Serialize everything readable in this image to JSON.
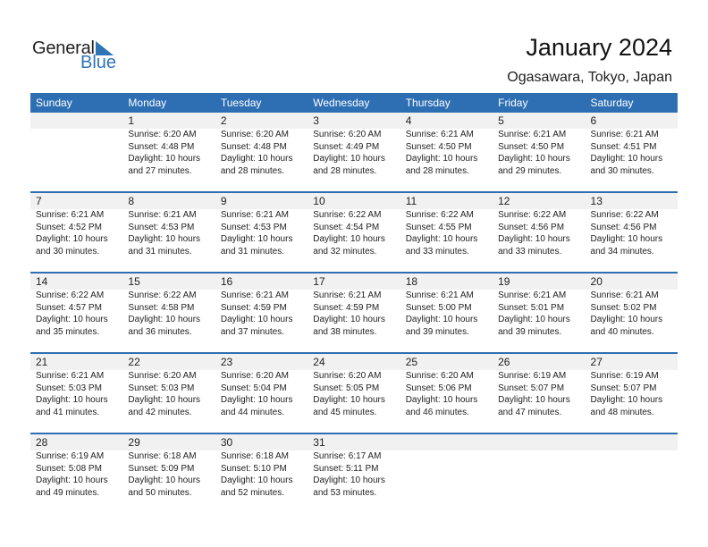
{
  "logo": {
    "general": "General",
    "blue": "Blue",
    "accent_color": "#2e75b6"
  },
  "header": {
    "title": "January 2024",
    "subtitle": "Ogasawara, Tokyo, Japan"
  },
  "colors": {
    "header_bg": "#2e6fb4",
    "date_band": "#f1f1f1"
  },
  "weekdays": [
    "Sunday",
    "Monday",
    "Tuesday",
    "Wednesday",
    "Thursday",
    "Friday",
    "Saturday"
  ],
  "weeks": [
    [
      null,
      {
        "day": "1",
        "sunrise": "Sunrise: 6:20 AM",
        "sunset": "Sunset: 4:48 PM",
        "daylight1": "Daylight: 10 hours",
        "daylight2": "and 27 minutes."
      },
      {
        "day": "2",
        "sunrise": "Sunrise: 6:20 AM",
        "sunset": "Sunset: 4:48 PM",
        "daylight1": "Daylight: 10 hours",
        "daylight2": "and 28 minutes."
      },
      {
        "day": "3",
        "sunrise": "Sunrise: 6:20 AM",
        "sunset": "Sunset: 4:49 PM",
        "daylight1": "Daylight: 10 hours",
        "daylight2": "and 28 minutes."
      },
      {
        "day": "4",
        "sunrise": "Sunrise: 6:21 AM",
        "sunset": "Sunset: 4:50 PM",
        "daylight1": "Daylight: 10 hours",
        "daylight2": "and 28 minutes."
      },
      {
        "day": "5",
        "sunrise": "Sunrise: 6:21 AM",
        "sunset": "Sunset: 4:50 PM",
        "daylight1": "Daylight: 10 hours",
        "daylight2": "and 29 minutes."
      },
      {
        "day": "6",
        "sunrise": "Sunrise: 6:21 AM",
        "sunset": "Sunset: 4:51 PM",
        "daylight1": "Daylight: 10 hours",
        "daylight2": "and 30 minutes."
      }
    ],
    [
      {
        "day": "7",
        "sunrise": "Sunrise: 6:21 AM",
        "sunset": "Sunset: 4:52 PM",
        "daylight1": "Daylight: 10 hours",
        "daylight2": "and 30 minutes."
      },
      {
        "day": "8",
        "sunrise": "Sunrise: 6:21 AM",
        "sunset": "Sunset: 4:53 PM",
        "daylight1": "Daylight: 10 hours",
        "daylight2": "and 31 minutes."
      },
      {
        "day": "9",
        "sunrise": "Sunrise: 6:21 AM",
        "sunset": "Sunset: 4:53 PM",
        "daylight1": "Daylight: 10 hours",
        "daylight2": "and 31 minutes."
      },
      {
        "day": "10",
        "sunrise": "Sunrise: 6:22 AM",
        "sunset": "Sunset: 4:54 PM",
        "daylight1": "Daylight: 10 hours",
        "daylight2": "and 32 minutes."
      },
      {
        "day": "11",
        "sunrise": "Sunrise: 6:22 AM",
        "sunset": "Sunset: 4:55 PM",
        "daylight1": "Daylight: 10 hours",
        "daylight2": "and 33 minutes."
      },
      {
        "day": "12",
        "sunrise": "Sunrise: 6:22 AM",
        "sunset": "Sunset: 4:56 PM",
        "daylight1": "Daylight: 10 hours",
        "daylight2": "and 33 minutes."
      },
      {
        "day": "13",
        "sunrise": "Sunrise: 6:22 AM",
        "sunset": "Sunset: 4:56 PM",
        "daylight1": "Daylight: 10 hours",
        "daylight2": "and 34 minutes."
      }
    ],
    [
      {
        "day": "14",
        "sunrise": "Sunrise: 6:22 AM",
        "sunset": "Sunset: 4:57 PM",
        "daylight1": "Daylight: 10 hours",
        "daylight2": "and 35 minutes."
      },
      {
        "day": "15",
        "sunrise": "Sunrise: 6:22 AM",
        "sunset": "Sunset: 4:58 PM",
        "daylight1": "Daylight: 10 hours",
        "daylight2": "and 36 minutes."
      },
      {
        "day": "16",
        "sunrise": "Sunrise: 6:21 AM",
        "sunset": "Sunset: 4:59 PM",
        "daylight1": "Daylight: 10 hours",
        "daylight2": "and 37 minutes."
      },
      {
        "day": "17",
        "sunrise": "Sunrise: 6:21 AM",
        "sunset": "Sunset: 4:59 PM",
        "daylight1": "Daylight: 10 hours",
        "daylight2": "and 38 minutes."
      },
      {
        "day": "18",
        "sunrise": "Sunrise: 6:21 AM",
        "sunset": "Sunset: 5:00 PM",
        "daylight1": "Daylight: 10 hours",
        "daylight2": "and 39 minutes."
      },
      {
        "day": "19",
        "sunrise": "Sunrise: 6:21 AM",
        "sunset": "Sunset: 5:01 PM",
        "daylight1": "Daylight: 10 hours",
        "daylight2": "and 39 minutes."
      },
      {
        "day": "20",
        "sunrise": "Sunrise: 6:21 AM",
        "sunset": "Sunset: 5:02 PM",
        "daylight1": "Daylight: 10 hours",
        "daylight2": "and 40 minutes."
      }
    ],
    [
      {
        "day": "21",
        "sunrise": "Sunrise: 6:21 AM",
        "sunset": "Sunset: 5:03 PM",
        "daylight1": "Daylight: 10 hours",
        "daylight2": "and 41 minutes."
      },
      {
        "day": "22",
        "sunrise": "Sunrise: 6:20 AM",
        "sunset": "Sunset: 5:03 PM",
        "daylight1": "Daylight: 10 hours",
        "daylight2": "and 42 minutes."
      },
      {
        "day": "23",
        "sunrise": "Sunrise: 6:20 AM",
        "sunset": "Sunset: 5:04 PM",
        "daylight1": "Daylight: 10 hours",
        "daylight2": "and 44 minutes."
      },
      {
        "day": "24",
        "sunrise": "Sunrise: 6:20 AM",
        "sunset": "Sunset: 5:05 PM",
        "daylight1": "Daylight: 10 hours",
        "daylight2": "and 45 minutes."
      },
      {
        "day": "25",
        "sunrise": "Sunrise: 6:20 AM",
        "sunset": "Sunset: 5:06 PM",
        "daylight1": "Daylight: 10 hours",
        "daylight2": "and 46 minutes."
      },
      {
        "day": "26",
        "sunrise": "Sunrise: 6:19 AM",
        "sunset": "Sunset: 5:07 PM",
        "daylight1": "Daylight: 10 hours",
        "daylight2": "and 47 minutes."
      },
      {
        "day": "27",
        "sunrise": "Sunrise: 6:19 AM",
        "sunset": "Sunset: 5:07 PM",
        "daylight1": "Daylight: 10 hours",
        "daylight2": "and 48 minutes."
      }
    ],
    [
      {
        "day": "28",
        "sunrise": "Sunrise: 6:19 AM",
        "sunset": "Sunset: 5:08 PM",
        "daylight1": "Daylight: 10 hours",
        "daylight2": "and 49 minutes."
      },
      {
        "day": "29",
        "sunrise": "Sunrise: 6:18 AM",
        "sunset": "Sunset: 5:09 PM",
        "daylight1": "Daylight: 10 hours",
        "daylight2": "and 50 minutes."
      },
      {
        "day": "30",
        "sunrise": "Sunrise: 6:18 AM",
        "sunset": "Sunset: 5:10 PM",
        "daylight1": "Daylight: 10 hours",
        "daylight2": "and 52 minutes."
      },
      {
        "day": "31",
        "sunrise": "Sunrise: 6:17 AM",
        "sunset": "Sunset: 5:11 PM",
        "daylight1": "Daylight: 10 hours",
        "daylight2": "and 53 minutes."
      },
      null,
      null,
      null
    ]
  ]
}
